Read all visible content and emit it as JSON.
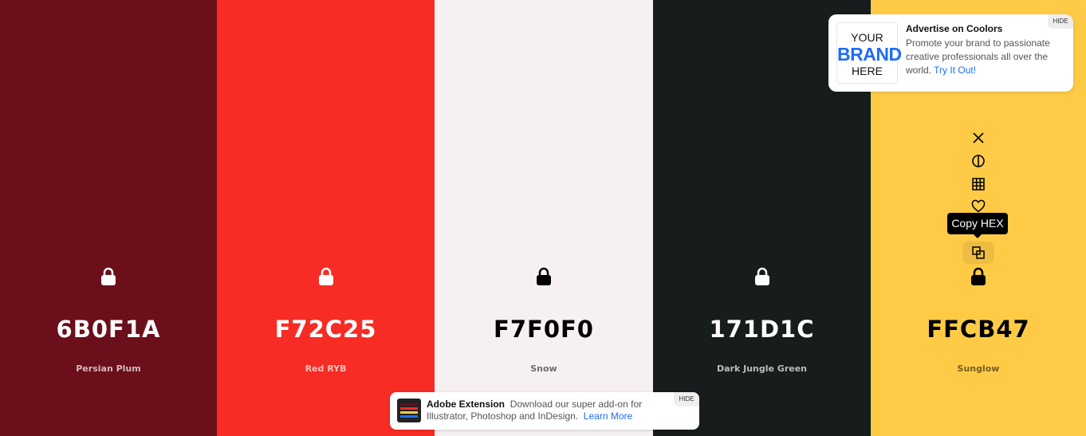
{
  "colors": [
    {
      "hex": "6B0F1A",
      "name": "Persian Plum",
      "bg": "#6B0F1A"
    },
    {
      "hex": "F72C25",
      "name": "Red RYB",
      "bg": "#F72C25"
    },
    {
      "hex": "F7F0F0",
      "name": "Snow",
      "bg": "#F7F0F0"
    },
    {
      "hex": "171D1C",
      "name": "Dark Jungle Green",
      "bg": "#171D1C"
    },
    {
      "hex": "FFCB47",
      "name": "Sunglow",
      "bg": "#FFCB47"
    }
  ],
  "tools": {
    "icons": [
      "close-icon",
      "contrast-icon",
      "grid-icon",
      "heart-icon",
      "copy-icon",
      "lock-icon"
    ],
    "tooltip": "Copy HEX"
  },
  "ad": {
    "brand_line1": "YOUR",
    "brand_line2": "BRAND",
    "brand_line3": "HERE",
    "title": "Advertise on Coolors",
    "text": "Promote your brand to passionate creative professionals all over the world.",
    "link": "Try It Out!",
    "hide": "HIDE"
  },
  "extension": {
    "title": "Adobe Extension",
    "text": "Download our super add-on for Illustrator, Photoshop and InDesign.",
    "link": "Learn More",
    "hide": "HIDE"
  }
}
